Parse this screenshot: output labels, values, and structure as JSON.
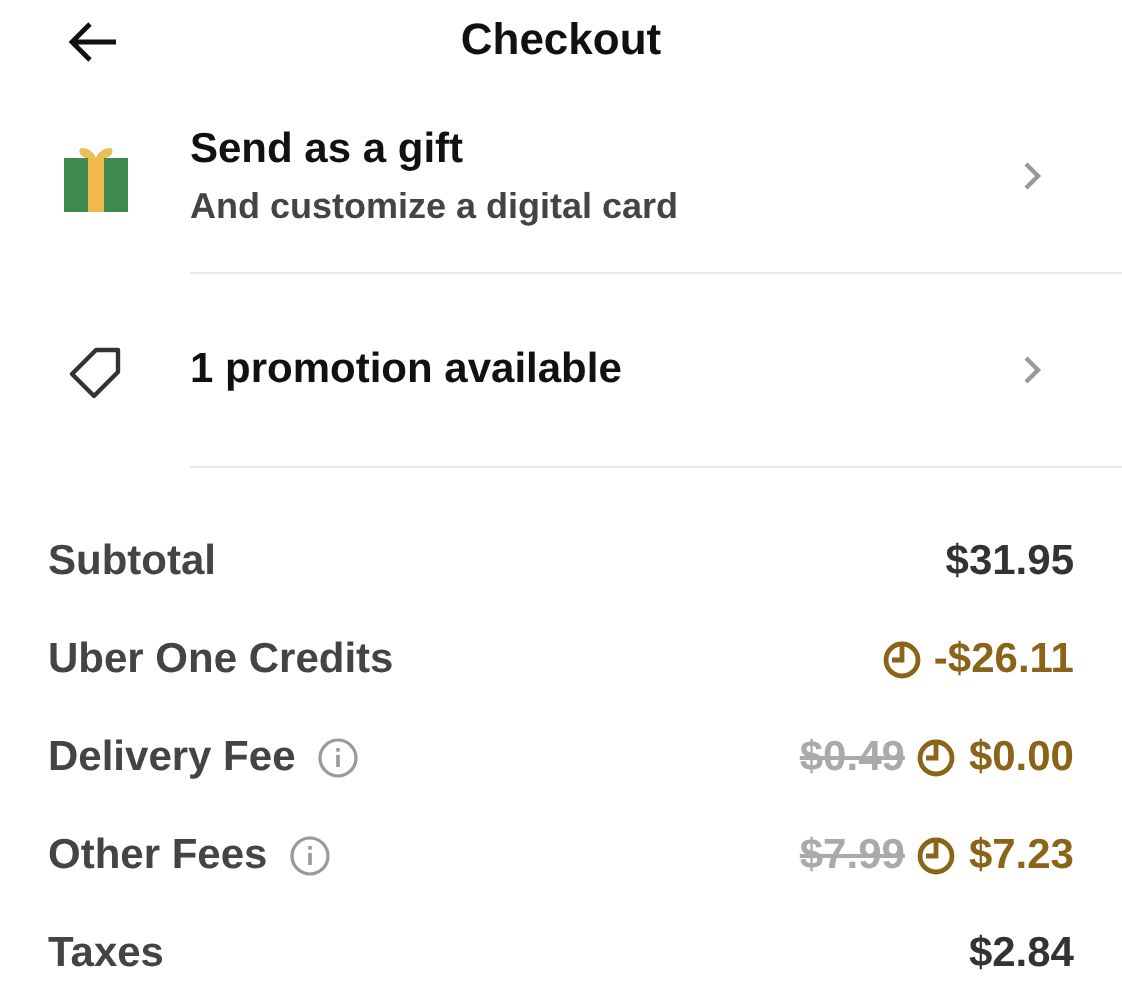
{
  "header": {
    "title": "Checkout"
  },
  "options": [
    {
      "kind": "gift",
      "title": "Send as a gift",
      "subtitle": "And customize a digital card"
    },
    {
      "kind": "promo",
      "title": "1 promotion available"
    }
  ],
  "fees": [
    {
      "label": "Subtotal",
      "info": false,
      "value": "$31.95",
      "uber_one": false
    },
    {
      "label": "Uber One Credits",
      "info": false,
      "value": "-$26.11",
      "uber_one": true
    },
    {
      "label": "Delivery Fee",
      "info": true,
      "original": "$0.49",
      "value": "$0.00",
      "uber_one": true
    },
    {
      "label": "Other Fees",
      "info": true,
      "original": "$7.99",
      "value": "$7.23",
      "uber_one": true
    },
    {
      "label": "Taxes",
      "info": false,
      "value": "$2.84",
      "uber_one": false
    }
  ]
}
